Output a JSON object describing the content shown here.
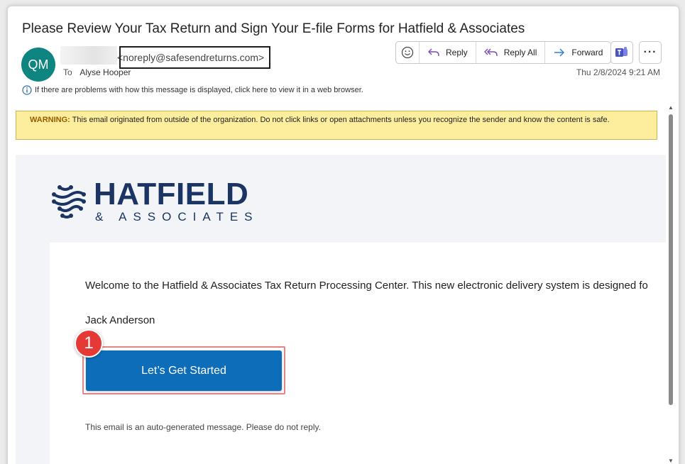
{
  "email": {
    "subject": "Please Review Your Tax Return and Sign Your E-file Forms for Hatfield & Associates",
    "avatar_initials": "QM",
    "sender_email": "<noreply@safesendreturns.com>",
    "to_label": "To",
    "to_name": "Alyse Hooper",
    "timestamp": "Thu 2/8/2024 9:21 AM",
    "info_message": "If there are problems with how this message is displayed, click here to view it in a web browser."
  },
  "toolbar": {
    "emoji_icon": "smiley-icon",
    "reply_label": "Reply",
    "reply_all_label": "Reply All",
    "forward_label": "Forward",
    "teams_icon": "teams-icon",
    "more_label": "···"
  },
  "warning": {
    "label": "WARNING:",
    "text": " This email originated from outside of the organization. Do not click links or open attachments unless you recognize the sender and know the content is safe."
  },
  "body": {
    "logo_title": "HATFIELD",
    "logo_subtitle": "& ASSOCIATES",
    "welcome_text": "Welcome to the Hatfield & Associates Tax Return Processing Center.  This new electronic delivery system is designed fo",
    "signature": "Jack Anderson",
    "cta_label": "Let’s Get Started",
    "step_number": "1",
    "footer_note": "This email is an auto-generated message. Please do not reply."
  },
  "colors": {
    "avatar": "#0f8581",
    "warning_bg": "#fdee9e",
    "cta": "#0e6db8",
    "brand": "#1a3463",
    "step_badge": "#e53935"
  }
}
